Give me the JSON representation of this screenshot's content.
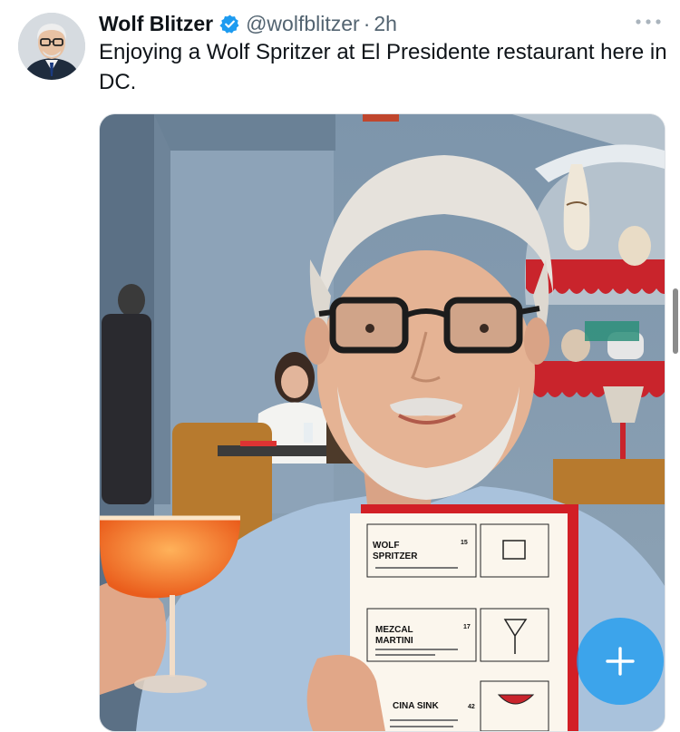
{
  "tweet": {
    "author_name": "Wolf Blitzer",
    "handle": "@wolfblitzer",
    "separator": "·",
    "time": "2h",
    "text": "Enjoying a Wolf Spritzer at El Presidente restaurant here in DC.",
    "verified": true
  },
  "menu": {
    "items": [
      {
        "name_line1": "WOLF",
        "name_line2": "SPRITZER",
        "price": "15"
      },
      {
        "name_line1": "MEZCAL",
        "name_line2": "MARTINI",
        "price": "17"
      },
      {
        "name_line1": "CINA SINK",
        "name_line2": "",
        "price": "42"
      }
    ]
  },
  "icons": {
    "verified": "verified-badge-icon",
    "more": "more-options-icon",
    "compose": "compose-plus-icon"
  },
  "colors": {
    "accent": "#1d9bf0",
    "text_primary": "#0f1419",
    "text_secondary": "#536471",
    "menu_red": "#d21f26"
  }
}
